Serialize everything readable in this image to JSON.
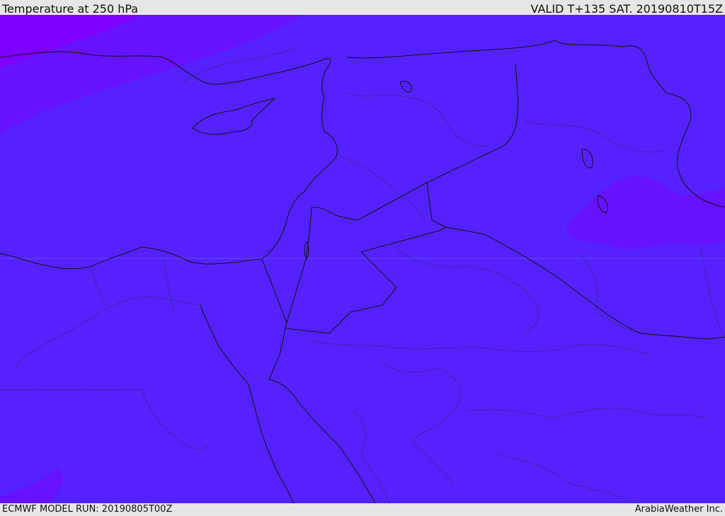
{
  "header": {
    "title": "Temperature at 250 hPa",
    "valid": "VALID T+135 SAT. 20190810T15Z"
  },
  "footer": {
    "model_run": "ECMWF MODEL RUN: 20190805T00Z",
    "credit": "ArabiaWeather Inc."
  },
  "map": {
    "base_color": "#5522ff",
    "cold_color": "#6612ff",
    "colder_color": "#8000ff",
    "border_color": "#111111"
  }
}
